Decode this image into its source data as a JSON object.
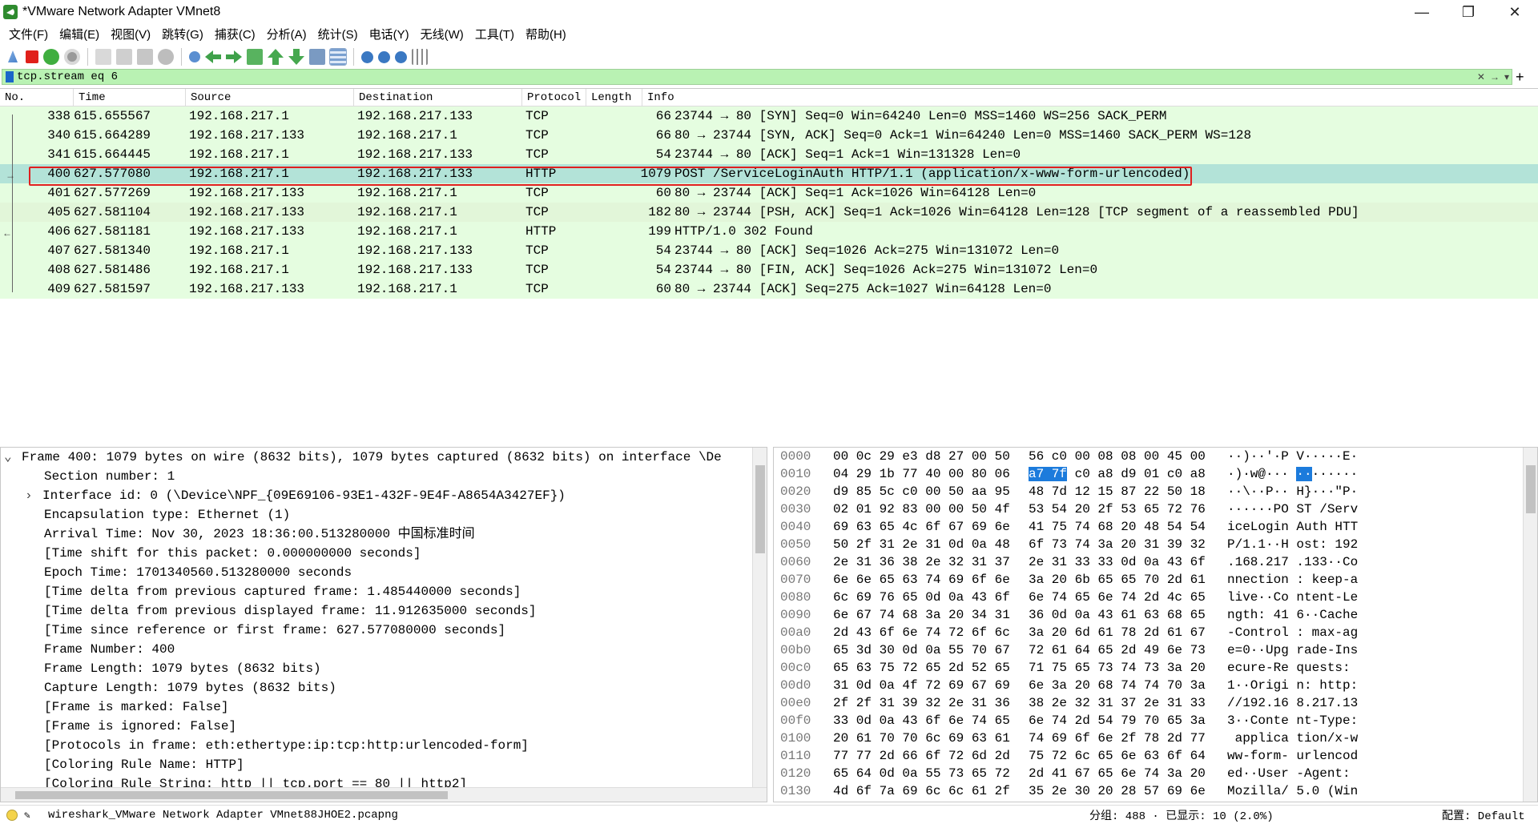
{
  "window": {
    "title": "*VMware Network Adapter VMnet8",
    "controls": [
      "—",
      "❐",
      "✕"
    ]
  },
  "menu": [
    "文件(F)",
    "编辑(E)",
    "视图(V)",
    "跳转(G)",
    "捕获(C)",
    "分析(A)",
    "统计(S)",
    "电话(Y)",
    "无线(W)",
    "工具(T)",
    "帮助(H)"
  ],
  "toolbar": {
    "icons": [
      "start-capture-icon",
      "stop-capture-icon",
      "restart-capture-icon",
      "capture-options-icon",
      "open-file-icon",
      "save-file-icon",
      "close-file-icon",
      "reload-icon",
      "find-packet-icon",
      "go-back-icon",
      "go-forward-icon",
      "go-to-packet-icon",
      "go-first-icon",
      "go-last-icon",
      "autoscroll-icon",
      "colorize-icon",
      "zoom-in-icon",
      "zoom-out-icon",
      "zoom-reset-icon",
      "resize-columns-icon"
    ]
  },
  "filter": {
    "value": "tcp.stream eq 6",
    "clear": "✕",
    "apply": "→",
    "dropdown": "▾",
    "add": "+"
  },
  "columns": [
    "No.",
    "Time",
    "Source",
    "Destination",
    "Protocol",
    "Length",
    "Info"
  ],
  "packets": [
    {
      "no": "338",
      "time": "615.655567",
      "src": "192.168.217.1",
      "dst": "192.168.217.133",
      "proto": "TCP",
      "len": "66",
      "info": "23744 → 80 [SYN] Seq=0 Win=64240 Len=0 MSS=1460 WS=256 SACK_PERM"
    },
    {
      "no": "340",
      "time": "615.664289",
      "src": "192.168.217.133",
      "dst": "192.168.217.1",
      "proto": "TCP",
      "len": "66",
      "info": "80 → 23744 [SYN, ACK] Seq=0 Ack=1 Win=64240 Len=0 MSS=1460 SACK_PERM WS=128"
    },
    {
      "no": "341",
      "time": "615.664445",
      "src": "192.168.217.1",
      "dst": "192.168.217.133",
      "proto": "TCP",
      "len": "54",
      "info": "23744 → 80 [ACK] Seq=1 Ack=1 Win=131328 Len=0"
    },
    {
      "no": "400",
      "time": "627.577080",
      "src": "192.168.217.1",
      "dst": "192.168.217.133",
      "proto": "HTTP",
      "len": "1079",
      "info": "POST /ServiceLoginAuth HTTP/1.1  (application/x-www-form-urlencoded)"
    },
    {
      "no": "401",
      "time": "627.577269",
      "src": "192.168.217.133",
      "dst": "192.168.217.1",
      "proto": "TCP",
      "len": "60",
      "info": "80 → 23744 [ACK] Seq=1 Ack=1026 Win=64128 Len=0"
    },
    {
      "no": "405",
      "time": "627.581104",
      "src": "192.168.217.133",
      "dst": "192.168.217.1",
      "proto": "TCP",
      "len": "182",
      "info": "80 → 23744 [PSH, ACK] Seq=1 Ack=1026 Win=64128 Len=128 [TCP segment of a reassembled PDU]"
    },
    {
      "no": "406",
      "time": "627.581181",
      "src": "192.168.217.133",
      "dst": "192.168.217.1",
      "proto": "HTTP",
      "len": "199",
      "info": "HTTP/1.0 302 Found"
    },
    {
      "no": "407",
      "time": "627.581340",
      "src": "192.168.217.1",
      "dst": "192.168.217.133",
      "proto": "TCP",
      "len": "54",
      "info": "23744 → 80 [ACK] Seq=1026 Ack=275 Win=131072 Len=0"
    },
    {
      "no": "408",
      "time": "627.581486",
      "src": "192.168.217.1",
      "dst": "192.168.217.133",
      "proto": "TCP",
      "len": "54",
      "info": "23744 → 80 [FIN, ACK] Seq=1026 Ack=275 Win=131072 Len=0"
    },
    {
      "no": "409",
      "time": "627.581597",
      "src": "192.168.217.133",
      "dst": "192.168.217.1",
      "proto": "TCP",
      "len": "60",
      "info": "80 → 23744 [ACK] Seq=275 Ack=1027 Win=64128 Len=0"
    }
  ],
  "selected_packet": "400",
  "details": {
    "frame": "Frame 400: 1079 bytes on wire (8632 bits), 1079 bytes captured (8632 bits) on interface \\De",
    "lines": [
      "Section number: 1",
      "Interface id: 0 (\\Device\\NPF_{09E69106-93E1-432F-9E4F-A8654A3427EF})",
      "Encapsulation type: Ethernet (1)",
      "Arrival Time: Nov 30, 2023 18:36:00.513280000 中国标准时间",
      "[Time shift for this packet: 0.000000000 seconds]",
      "Epoch Time: 1701340560.513280000 seconds",
      "[Time delta from previous captured frame: 1.485440000 seconds]",
      "[Time delta from previous displayed frame: 11.912635000 seconds]",
      "[Time since reference or first frame: 627.577080000 seconds]",
      "Frame Number: 400",
      "Frame Length: 1079 bytes (8632 bits)",
      "Capture Length: 1079 bytes (8632 bits)",
      "[Frame is marked: False]",
      "[Frame is ignored: False]",
      "[Protocols in frame: eth:ethertype:ip:tcp:http:urlencoded-form]",
      "[Coloring Rule Name: HTTP]",
      "[Coloring Rule String: http || tcp.port == 80 || http2]"
    ]
  },
  "bytes": [
    {
      "off": "0000",
      "h1": "00 0c 29 e3 d8 27 00 50",
      "h2": "56 c0 00 08 08 00 45 00",
      "a1": "··)··'·P",
      "a2": "V·····E·"
    },
    {
      "off": "0010",
      "h1": "04 29 1b 77 40 00 80 06",
      "h2sel": "a7 7f",
      "h2": " c0 a8 d9 01 c0 a8",
      "a1": "·)·w@···",
      "a2sel": "··",
      "a2": "······"
    },
    {
      "off": "0020",
      "h1": "d9 85 5c c0 00 50 aa 95",
      "h2": "48 7d 12 15 87 22 50 18",
      "a1": "··\\··P··",
      "a2": "H}···\"P·"
    },
    {
      "off": "0030",
      "h1": "02 01 92 83 00 00 50 4f",
      "h2": "53 54 20 2f 53 65 72 76",
      "a1": "······PO",
      "a2": "ST /Serv"
    },
    {
      "off": "0040",
      "h1": "69 63 65 4c 6f 67 69 6e",
      "h2": "41 75 74 68 20 48 54 54",
      "a1": "iceLogin",
      "a2": "Auth HTT"
    },
    {
      "off": "0050",
      "h1": "50 2f 31 2e 31 0d 0a 48",
      "h2": "6f 73 74 3a 20 31 39 32",
      "a1": "P/1.1··H",
      "a2": "ost: 192"
    },
    {
      "off": "0060",
      "h1": "2e 31 36 38 2e 32 31 37",
      "h2": "2e 31 33 33 0d 0a 43 6f",
      "a1": ".168.217",
      "a2": ".133··Co"
    },
    {
      "off": "0070",
      "h1": "6e 6e 65 63 74 69 6f 6e",
      "h2": "3a 20 6b 65 65 70 2d 61",
      "a1": "nnection",
      "a2": ": keep-a"
    },
    {
      "off": "0080",
      "h1": "6c 69 76 65 0d 0a 43 6f",
      "h2": "6e 74 65 6e 74 2d 4c 65",
      "a1": "live··Co",
      "a2": "ntent-Le"
    },
    {
      "off": "0090",
      "h1": "6e 67 74 68 3a 20 34 31",
      "h2": "36 0d 0a 43 61 63 68 65",
      "a1": "ngth: 41",
      "a2": "6··Cache"
    },
    {
      "off": "00a0",
      "h1": "2d 43 6f 6e 74 72 6f 6c",
      "h2": "3a 20 6d 61 78 2d 61 67",
      "a1": "-Control",
      "a2": ": max-ag"
    },
    {
      "off": "00b0",
      "h1": "65 3d 30 0d 0a 55 70 67",
      "h2": "72 61 64 65 2d 49 6e 73",
      "a1": "e=0··Upg",
      "a2": "rade-Ins"
    },
    {
      "off": "00c0",
      "h1": "65 63 75 72 65 2d 52 65",
      "h2": "71 75 65 73 74 73 3a 20",
      "a1": "ecure-Re",
      "a2": "quests: "
    },
    {
      "off": "00d0",
      "h1": "31 0d 0a 4f 72 69 67 69",
      "h2": "6e 3a 20 68 74 74 70 3a",
      "a1": "1··Origi",
      "a2": "n: http:"
    },
    {
      "off": "00e0",
      "h1": "2f 2f 31 39 32 2e 31 36",
      "h2": "38 2e 32 31 37 2e 31 33",
      "a1": "//192.16",
      "a2": "8.217.13"
    },
    {
      "off": "00f0",
      "h1": "33 0d 0a 43 6f 6e 74 65",
      "h2": "6e 74 2d 54 79 70 65 3a",
      "a1": "3··Conte",
      "a2": "nt-Type:"
    },
    {
      "off": "0100",
      "h1": "20 61 70 70 6c 69 63 61",
      "h2": "74 69 6f 6e 2f 78 2d 77",
      "a1": " applica",
      "a2": "tion/x-w"
    },
    {
      "off": "0110",
      "h1": "77 77 2d 66 6f 72 6d 2d",
      "h2": "75 72 6c 65 6e 63 6f 64",
      "a1": "ww-form-",
      "a2": "urlencod"
    },
    {
      "off": "0120",
      "h1": "65 64 0d 0a 55 73 65 72",
      "h2": "2d 41 67 65 6e 74 3a 20",
      "a1": "ed··User",
      "a2": "-Agent: "
    },
    {
      "off": "0130",
      "h1": "4d 6f 7a 69 6c 6c 61 2f",
      "h2": "35 2e 30 20 28 57 69 6e",
      "a1": "Mozilla/",
      "a2": "5.0 (Win"
    }
  ],
  "status": {
    "file": "wireshark_VMware Network Adapter VMnet88JHOE2.pcapng",
    "stats": "分组: 488 · 已显示: 10 (2.0%)",
    "profile": "配置: Default"
  },
  "colors": {
    "row_bg": "#e5fde0",
    "selected_row_bg": "#b3e3d8",
    "filter_bg": "#b9f2b3",
    "highlight_border": "#e02020",
    "byte_selection": "#1c7bdc"
  }
}
